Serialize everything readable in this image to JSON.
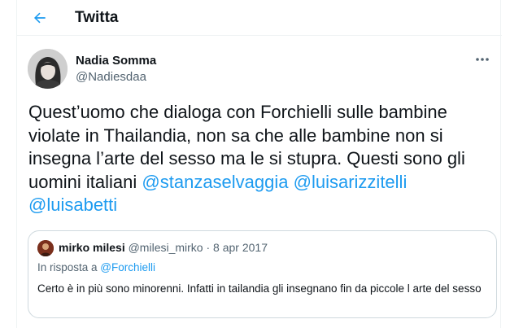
{
  "header": {
    "title": "Twitta",
    "back_icon": "arrow-left-icon",
    "accent": "#1d9bf0"
  },
  "tweet": {
    "author_name": "Nadia Somma",
    "author_handle": "@Nadiesdaa",
    "text_line_1": "Quest’uomo che dialoga con Forchielli sulle bambine",
    "text_line_2": "violate in Thailandia, non sa che alle bambine non si",
    "text_line_3": "insegna l’arte del sesso ma le si stupra. Questi  sono gli",
    "text_line_4_prefix": "uomini italiani ",
    "mentions": [
      "@stanzaselvaggia",
      "@luisarizzitelli",
      "@luisabetti"
    ],
    "more_icon": "more-horizontal-icon"
  },
  "quote": {
    "author_name": "mirko milesi",
    "author_handle": "@milesi_mirko",
    "separator": "·",
    "date": "8 apr 2017",
    "reply_prefix": "In risposta a ",
    "reply_to": "@Forchielli",
    "text": "Certo è in più sono minorenni. Infatti in tailandia gli insegnano fin da piccole l arte del sesso"
  }
}
